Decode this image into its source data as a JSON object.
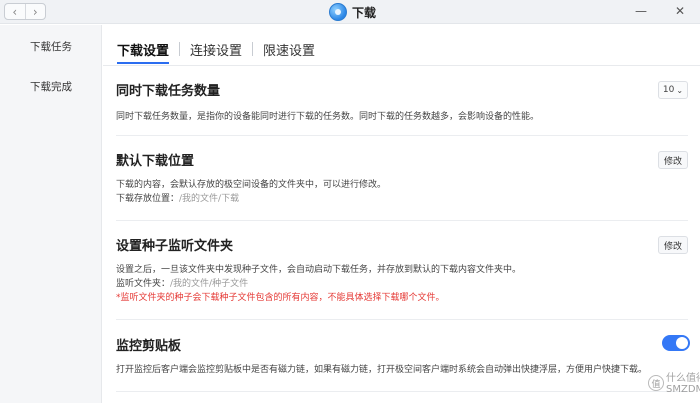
{
  "window": {
    "title": "下载",
    "back_glyph": "‹",
    "forward_glyph": "›",
    "minimize_glyph": "—",
    "close_glyph": "✕"
  },
  "sidebar": {
    "items": [
      {
        "label": "下载任务",
        "active": true
      },
      {
        "label": "下载完成",
        "active": false
      }
    ]
  },
  "tabs": [
    {
      "label": "下载设置",
      "active": true
    },
    {
      "label": "连接设置",
      "active": false
    },
    {
      "label": "限速设置",
      "active": false
    }
  ],
  "sections": {
    "concurrent": {
      "title": "同时下载任务数量",
      "description": "同时下载任务数量，是指你的设备能同时进行下载的任务数。同时下载的任务数越多，会影响设备的性能。",
      "value": "10",
      "dropdown_glyph": "⌄"
    },
    "default_location": {
      "title": "默认下载位置",
      "description": "下载的内容，会默认存放的极空间设备的文件夹中，可以进行修改。",
      "path_label": "下载存放位置：",
      "path_value": "/我的文件/下载",
      "edit_label": "修改"
    },
    "torrent_folder": {
      "title": "设置种子监听文件夹",
      "description": "设置之后，一旦该文件夹中发现种子文件，会自动启动下载任务，并存放到默认的下载内容文件夹中。",
      "path_label": "监听文件夹：",
      "path_value": "/我的文件/种子文件",
      "warning": "*监听文件夹的种子会下载种子文件包含的所有内容，不能具体选择下载哪个文件。",
      "edit_label": "修改"
    },
    "clipboard": {
      "title": "监控剪贴板",
      "description": "打开监控后客户端会监控剪贴板中是否有磁力链，如果有磁力链，打开极空间客户端时系统会自动弹出快捷浮层，方便用户快捷下载。",
      "enabled": true
    }
  },
  "watermark": {
    "badge": "值",
    "line1": "什么值得买",
    "line2": "SMZDM"
  },
  "colors": {
    "accent": "#3478f6",
    "warning": "#e53935",
    "sidebar_bg": "#f5f6f8"
  }
}
